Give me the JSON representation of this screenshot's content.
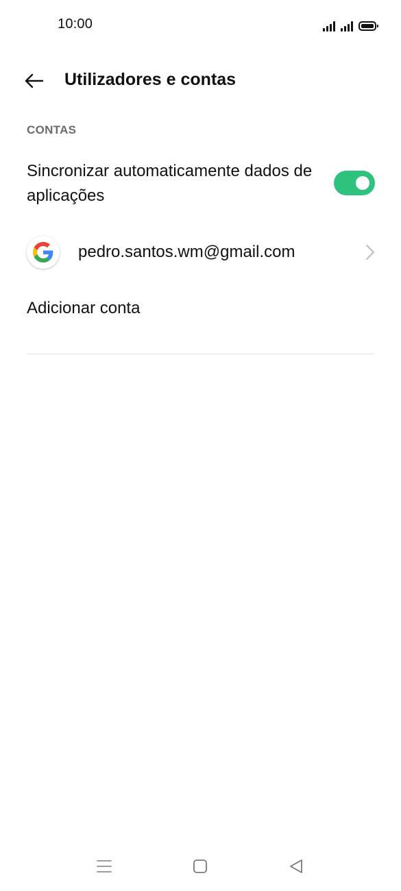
{
  "status_bar": {
    "time": "10:00",
    "icons": [
      "signal-icon",
      "signal-icon",
      "battery-icon"
    ]
  },
  "header": {
    "title": "Utilizadores e contas",
    "back_icon": "arrow-left-icon"
  },
  "section": {
    "title": "CONTAS"
  },
  "sync": {
    "label": "Sincronizar automaticamente dados de aplicações",
    "enabled": true,
    "toggle_color": "#2ec27e"
  },
  "account": {
    "email": "pedro.santos.wm@gmail.com",
    "icon": "google-icon",
    "chevron_icon": "chevron-right-icon"
  },
  "add_account": {
    "label": "Adicionar conta"
  },
  "nav_bar": {
    "buttons": [
      "menu-icon",
      "home-icon",
      "back-triangle-icon"
    ]
  }
}
